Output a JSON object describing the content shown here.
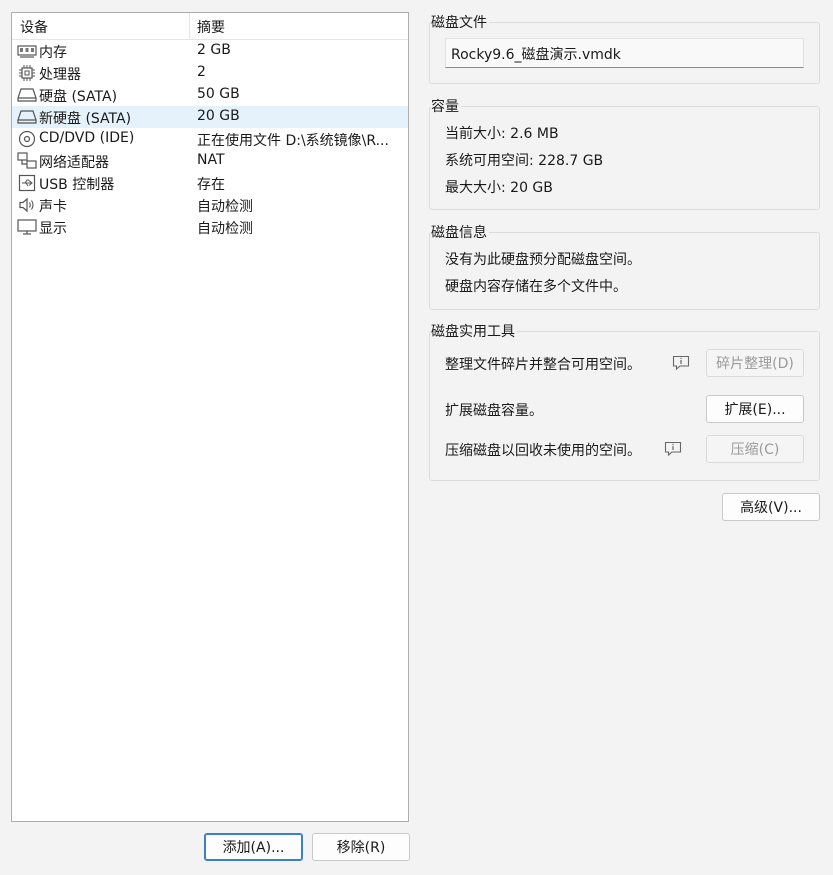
{
  "device_list": {
    "header": {
      "device": "设备",
      "summary": "摘要"
    },
    "items": [
      {
        "icon": "memory-icon",
        "name": "内存",
        "summary": "2 GB"
      },
      {
        "icon": "processor-icon",
        "name": "处理器",
        "summary": "2"
      },
      {
        "icon": "hard-disk-icon",
        "name": "硬盘 (SATA)",
        "summary": "50 GB"
      },
      {
        "icon": "hard-disk-icon",
        "name": "新硬盘 (SATA)",
        "summary": "20 GB"
      },
      {
        "icon": "cd-dvd-icon",
        "name": "CD/DVD (IDE)",
        "summary": "正在使用文件 D:\\系统镜像\\R..."
      },
      {
        "icon": "network-adapter-icon",
        "name": "网络适配器",
        "summary": "NAT"
      },
      {
        "icon": "usb-controller-icon",
        "name": "USB 控制器",
        "summary": "存在"
      },
      {
        "icon": "sound-card-icon",
        "name": "声卡",
        "summary": "自动检测"
      },
      {
        "icon": "display-icon",
        "name": "显示",
        "summary": "自动检测"
      }
    ],
    "selected_index": 3
  },
  "buttons": {
    "add": "添加(A)...",
    "remove": "移除(R)",
    "advanced": "高级(V)..."
  },
  "disk_file": {
    "title": "磁盘文件",
    "value": "Rocky9.6_磁盘演示.vmdk"
  },
  "capacity": {
    "title": "容量",
    "current_size": "当前大小: 2.6 MB",
    "system_free": "系统可用空间: 228.7 GB",
    "max_size": "最大大小: 20 GB"
  },
  "disk_info": {
    "title": "磁盘信息",
    "line1": "没有为此硬盘预分配磁盘空间。",
    "line2": "硬盘内容存储在多个文件中。"
  },
  "disk_utilities": {
    "title": "磁盘实用工具",
    "defrag_text": "整理文件碎片并整合可用空间。",
    "defrag_button": "碎片整理(D)",
    "expand_text": "扩展磁盘容量。",
    "expand_button": "扩展(E)...",
    "compact_text": "压缩磁盘以回收未使用的空间。",
    "compact_button": "压缩(C)"
  },
  "colors": {
    "selected_row": "#e5f1fb",
    "primary_border": "#3b7fc4"
  }
}
